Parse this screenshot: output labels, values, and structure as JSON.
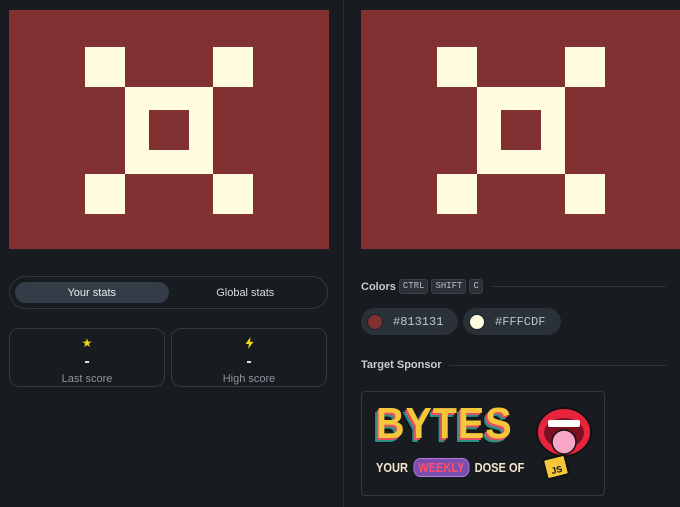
{
  "stats": {
    "tabs": [
      {
        "label": "Your stats",
        "active": true
      },
      {
        "label": "Global stats",
        "active": false
      }
    ],
    "last_score": {
      "icon": "star-icon",
      "value": "-",
      "label": "Last score"
    },
    "high_score": {
      "icon": "lightning-icon",
      "value": "-",
      "label": "High score"
    }
  },
  "colors": {
    "title": "Colors",
    "shortcut_keys": [
      "CTRL",
      "SHIFT",
      "C"
    ],
    "swatches": [
      {
        "hex": "#813131"
      },
      {
        "hex": "#FFFCDF"
      }
    ]
  },
  "sponsor": {
    "title": "Target Sponsor",
    "brand": "BYTES",
    "tagline_before": "YOUR",
    "tagline_highlight": "WEEKLY",
    "tagline_after": "DOSE OF",
    "badge": "JS"
  },
  "theme": {
    "background": "#813131",
    "foreground": "#FFFCDF",
    "page_bg": "#181b1f"
  }
}
